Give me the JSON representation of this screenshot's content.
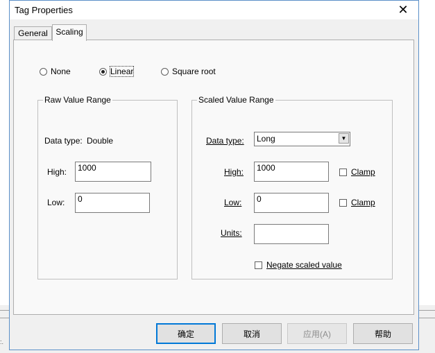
{
  "window": {
    "title": "Tag Properties"
  },
  "tabs": [
    {
      "label": "General"
    },
    {
      "label": "Scaling"
    }
  ],
  "scaling_mode": {
    "none": "None",
    "linear": "Linear",
    "square_root": "Square root",
    "selected": "Linear"
  },
  "raw": {
    "title": "Raw Value Range",
    "data_type_label": "Data type:",
    "data_type_value": "Double",
    "high_label": "High:",
    "high_value": "1000",
    "low_label": "Low:",
    "low_value": "0"
  },
  "scaled": {
    "title": "Scaled Value Range",
    "data_type_label": "Data type:",
    "data_type_value": "Long",
    "high_label": "High:",
    "high_value": "1000",
    "low_label": "Low:",
    "low_value": "0",
    "units_label": "Units:",
    "units_value": "",
    "clamp_label": "Clamp",
    "negate_label": "Negate scaled value"
  },
  "buttons": {
    "ok": "确定",
    "cancel": "取消",
    "apply": "应用(A)",
    "help": "帮助"
  },
  "background": {
    "mark": ":."
  },
  "colors": {
    "accent": "#0078d7",
    "border": "#5a8fc8",
    "dialog_bg": "#f0f0f0"
  }
}
